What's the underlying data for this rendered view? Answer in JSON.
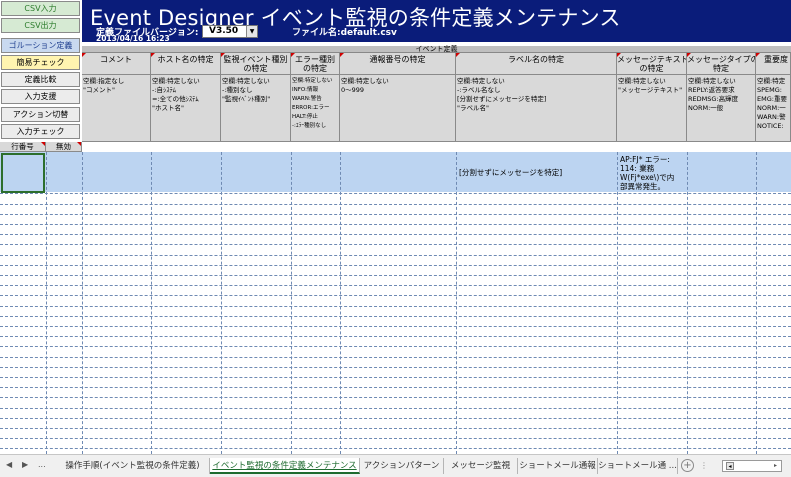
{
  "left_buttons": [
    {
      "label": "CSV入力",
      "style": "green"
    },
    {
      "label": "CSV出力",
      "style": "green"
    },
    {
      "label": "ゴルーション定義",
      "style": "blue"
    },
    {
      "label": "簡易チェック",
      "style": "yellow"
    },
    {
      "label": "定義比較",
      "style": "plain"
    },
    {
      "label": "入力支援",
      "style": "plain"
    },
    {
      "label": "アクション切替",
      "style": "plain"
    },
    {
      "label": "入力チェック",
      "style": "plain"
    }
  ],
  "header": {
    "title": "Event Designer イベント監視の条件定義メンテナンス",
    "version_label": "定義ファイルバージョン:",
    "version_value": "V3.50",
    "date": "2013/04/16 16:23",
    "filename": "ファイル名:default.csv"
  },
  "group_header": "イベント定義",
  "columns": [
    {
      "label": "コメント",
      "desc": "空欄:指定なし\n\"コメント\""
    },
    {
      "label": "ホスト名の特定",
      "desc": "空欄:特定しない\n-:自ｼｽﾃﾑ\n=:全ての他ｼｽﾃﾑ\n\"ホスト名\""
    },
    {
      "label": "監視イベント種別\nの特定",
      "desc": "空欄:特定しない\n-:種別なし\n\"監視ｲﾍﾞﾝﾄ種別\""
    },
    {
      "label": "エラー種別\nの特定",
      "desc": "空欄:特定しない\nINFO:情報\nWARN:警告\nERROR:エラー\nHALT:停止\n-:ｴﾗｰ種別なし"
    },
    {
      "label": "通報番号の特定",
      "desc": "空欄:特定しない\n0〜999"
    },
    {
      "label": "ラベル名の特定",
      "desc": "空欄:特定しない\n-:ラベル名なし\n[分割せずにメッセージを特定]\n\"ラベル名\""
    },
    {
      "label": "メッセージテキスト\nの特定",
      "desc": "空欄:特定しない\n\"メッセージテキスト\""
    },
    {
      "label": "メッセージタイプの\n特定",
      "desc": "空欄:特定しない\nREPLY:返答要求\nREDMSG:高輝度\nNORM:一般"
    },
    {
      "label": "重要度",
      "desc": "空欄:特定\nSPEMG:\nEMG:重要\nNORM:一\nWARN:警\nNOTICE:"
    }
  ],
  "row_headers": [
    {
      "label": "行番号"
    },
    {
      "label": "無効"
    }
  ],
  "row1": {
    "label_cell": "[分割せずにメッセージを特定]",
    "message_cell": "AP:FJ* エラー:\n114: 業務\nW(Fj*exe\\)で内\n部異常発生。"
  },
  "tabs": [
    {
      "label": "操作手順(イベント監視の条件定義)",
      "active": false
    },
    {
      "label": "イベント監視の条件定義メンテナンス",
      "active": true
    },
    {
      "label": "アクションパターン",
      "active": false
    },
    {
      "label": "メッセージ監視",
      "active": false
    },
    {
      "label": "ショートメール通報",
      "active": false
    },
    {
      "label": "ショートメール通 ...",
      "active": false
    }
  ],
  "nav": {
    "prev": "◀",
    "next": "▶",
    "more": "..."
  },
  "colors": {
    "banner": "#0a1c7a",
    "selected_row": "#bcd4f1",
    "active_tab": "#1e6b2f"
  }
}
